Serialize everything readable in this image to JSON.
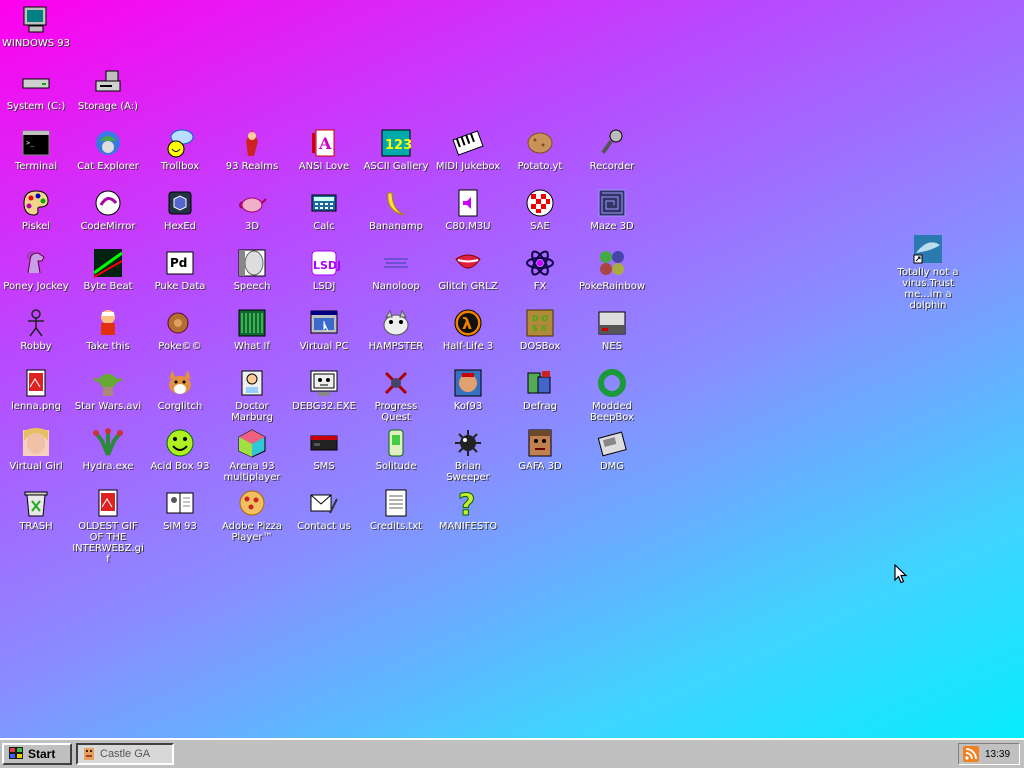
{
  "desktop": {
    "icons": [
      {
        "label": "WINDOWS 93",
        "icon": "computer-icon"
      },
      {
        "label": "System (C:)",
        "icon": "drive-icon"
      },
      {
        "label": "Storage (A:)",
        "icon": "floppy-drive-icon"
      },
      {
        "label": "Terminal",
        "icon": "terminal-icon"
      },
      {
        "label": "Cat Explorer",
        "icon": "cat-explorer-icon"
      },
      {
        "label": "Trollbox",
        "icon": "trollbox-icon"
      },
      {
        "label": "93 Realms",
        "icon": "93-realms-icon"
      },
      {
        "label": "ANSI Love",
        "icon": "ansi-love-icon"
      },
      {
        "label": "ASCII Gallery",
        "icon": "ascii-gallery-icon"
      },
      {
        "label": "MIDI Jukebox",
        "icon": "piano-icon"
      },
      {
        "label": "Potato.yt",
        "icon": "potato-icon"
      },
      {
        "label": "Recorder",
        "icon": "microphone-icon"
      },
      {
        "label": "Piskel",
        "icon": "palette-icon"
      },
      {
        "label": "CodeMirror",
        "icon": "codemirror-icon"
      },
      {
        "label": "HexEd",
        "icon": "cube-icon"
      },
      {
        "label": "3D",
        "icon": "teapot-icon"
      },
      {
        "label": "Calc",
        "icon": "calculator-icon"
      },
      {
        "label": "Bananamp",
        "icon": "banana-icon"
      },
      {
        "label": "C80.M3U",
        "icon": "audio-file-icon"
      },
      {
        "label": "SAE",
        "icon": "amiga-ball-icon"
      },
      {
        "label": "Maze 3D",
        "icon": "maze-icon"
      },
      {
        "label": "Poney Jockey",
        "icon": "pony-icon"
      },
      {
        "label": "Byte Beat",
        "icon": "bytebeat-icon"
      },
      {
        "label": "Puke Data",
        "icon": "pd-icon"
      },
      {
        "label": "Speech",
        "icon": "speech-face-icon"
      },
      {
        "label": "LSDJ",
        "icon": "lsdj-icon"
      },
      {
        "label": "Nanoloop",
        "icon": "nanoloop-icon"
      },
      {
        "label": "Glitch GRLZ",
        "icon": "lips-icon"
      },
      {
        "label": "FX",
        "icon": "atom-icon"
      },
      {
        "label": "PokeRainbow",
        "icon": "pokerainbow-icon"
      },
      {
        "label": "Robby",
        "icon": "stick-figure-icon"
      },
      {
        "label": "Take this",
        "icon": "take-this-icon"
      },
      {
        "label": "Poke©©",
        "icon": "pokecc-icon"
      },
      {
        "label": "What If",
        "icon": "what-if-icon"
      },
      {
        "label": "Virtual PC",
        "icon": "virtual-pc-icon"
      },
      {
        "label": "HAMPSTER",
        "icon": "hamster-icon"
      },
      {
        "label": "Half-Life 3",
        "icon": "half-life-icon"
      },
      {
        "label": "DOSBox",
        "icon": "dosbox-icon"
      },
      {
        "label": "NES",
        "icon": "nes-icon"
      },
      {
        "label": "lenna.png",
        "icon": "image-file-icon"
      },
      {
        "label": "Star Wars.avi",
        "icon": "yoda-icon"
      },
      {
        "label": "Corglitch",
        "icon": "corgi-icon"
      },
      {
        "label": "Doctor Marburg",
        "icon": "doctor-icon"
      },
      {
        "label": "DEBG32.EXE",
        "icon": "debug-icon"
      },
      {
        "label": "Progress Quest",
        "icon": "progress-quest-icon"
      },
      {
        "label": "Kof93",
        "icon": "fighter-icon"
      },
      {
        "label": "Defrag",
        "icon": "defrag-icon"
      },
      {
        "label": "Modded BeepBox",
        "icon": "green-ring-icon"
      },
      {
        "label": "Virtual Girl",
        "icon": "virtual-girl-icon"
      },
      {
        "label": "Hydra.exe",
        "icon": "hydra-icon"
      },
      {
        "label": "Acid Box 93",
        "icon": "smiley-icon"
      },
      {
        "label": "Arena 93 multiplayer",
        "icon": "arena-cube-icon"
      },
      {
        "label": "SMS",
        "icon": "sms-console-icon"
      },
      {
        "label": "Solitude",
        "icon": "solitude-icon"
      },
      {
        "label": "Brian Sweeper",
        "icon": "mine-icon"
      },
      {
        "label": "GAFA 3D",
        "icon": "doom-guy-icon"
      },
      {
        "label": "DMG",
        "icon": "gameboy-icon"
      },
      {
        "label": "TRASH",
        "icon": "trash-icon"
      },
      {
        "label": "OLDEST GIF OF THE INTERWEBZ.gif",
        "icon": "gif-file-icon"
      },
      {
        "label": "SIM 93",
        "icon": "sim-book-icon"
      },
      {
        "label": "Adobe Pizza Player™",
        "icon": "pizza-icon"
      },
      {
        "label": "Contact us",
        "icon": "contact-icon"
      },
      {
        "label": "Credits.txt",
        "icon": "text-file-icon"
      },
      {
        "label": "MANIFESTO",
        "icon": "question-icon"
      },
      {
        "label": "Totally not a virus.Trust me...im a dolphin",
        "icon": "dolphin-shortcut-icon"
      }
    ]
  },
  "taskbar": {
    "start_label": "Start",
    "tasks": [
      {
        "label": "Castle GA"
      }
    ],
    "clock": "13:39"
  }
}
